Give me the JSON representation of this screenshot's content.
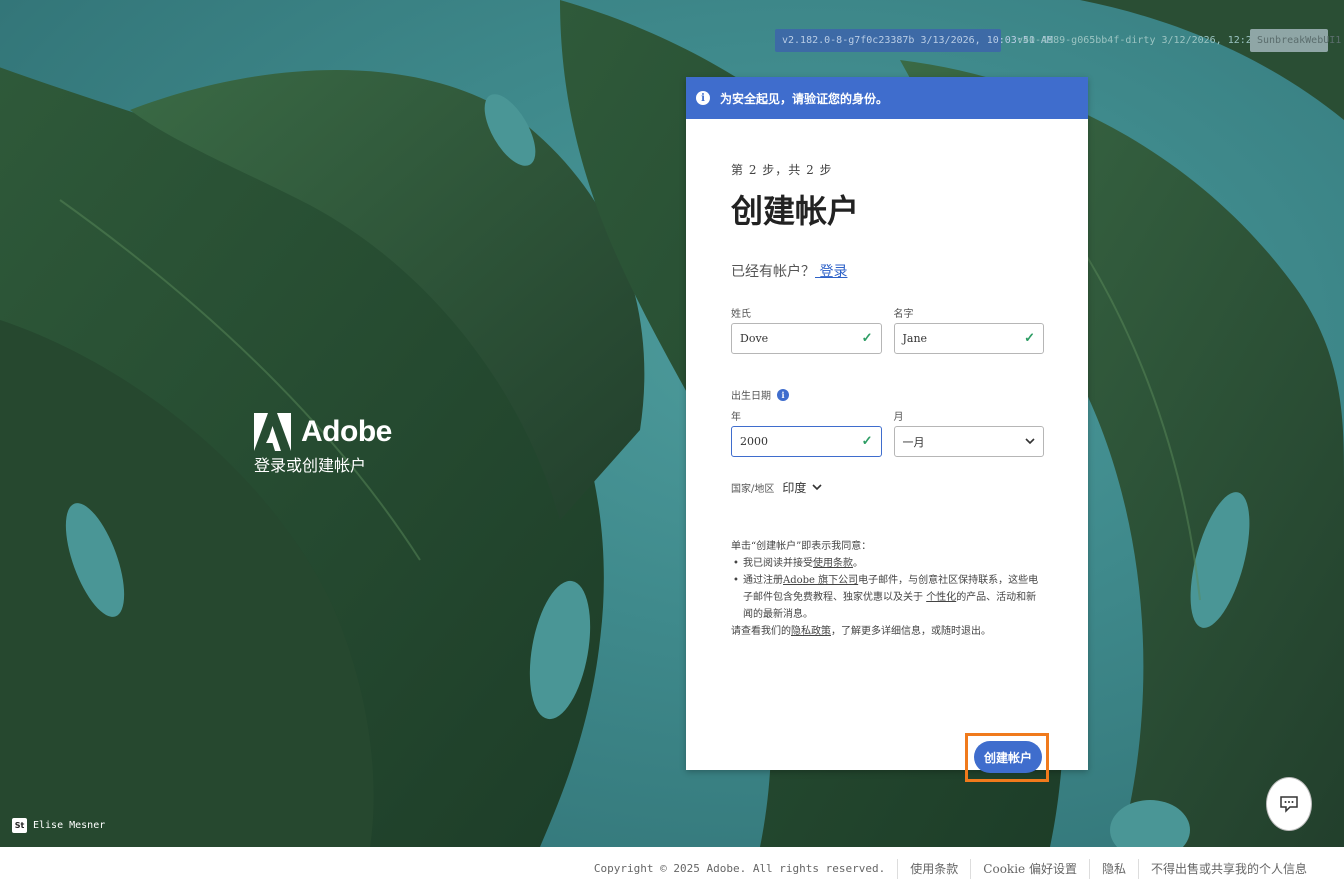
{
  "build": {
    "version_1": "v2.182.0-8-g7f0c23387b 3/13/2026, 10:03:51 AM",
    "version_2": "v40-4989-g065bb4f-dirty 3/12/2026, 12:29:36 PM",
    "app": "SunbreakWebUI1"
  },
  "brand": {
    "name": "Adobe",
    "tagline": "登录或创建帐户"
  },
  "notice": {
    "text": "为安全起见，请验证您的身份。",
    "icon": "info-icon"
  },
  "form": {
    "step": "第 2 步，共 2 步",
    "title": "创建帐户",
    "have_account": "已经有帐户？",
    "signin_link": " 登录",
    "last_name": {
      "label": "姓氏",
      "value": "Dove"
    },
    "first_name": {
      "label": "名字",
      "value": "Jane"
    },
    "dob_label": "出生日期",
    "year": {
      "label": "年",
      "value": "2000"
    },
    "month": {
      "label": "月",
      "value": "一月"
    },
    "country_label": "国家/地区",
    "country_value": "印度",
    "legal": {
      "intro": "单击“创建帐户”即表示我同意：",
      "item1_pre": "我已阅读并接受",
      "item1_link": "使用条款",
      "item1_post": "。",
      "item2_pre": "通过注册",
      "item2_link": "Adobe 旗下公司",
      "item2_mid": "电子邮件，与创意社区保持联系，这些电子邮件包含免费教程、独家优惠以及关于 ",
      "item2_link2": "个性化",
      "item2_post": "的产品、活动和新闻的最新消息。",
      "outro_pre": "请查看我们的",
      "outro_link": "隐私政策",
      "outro_post": "，了解更多详细信息，或随时退出。"
    },
    "submit": "创建帐户"
  },
  "credit": {
    "logo": "St",
    "name": "Elise Mesner"
  },
  "footer": {
    "copyright": "Copyright © 2025 Adobe. All rights reserved.",
    "terms": "使用条款",
    "cookie": "Cookie 偏好设置",
    "privacy": "隐私",
    "do_not_sell": "不得出售或共享我的个人信息"
  },
  "colors": {
    "accent": "#3f6dcd",
    "success": "#2d9d64",
    "highlight": "#f07a1c"
  }
}
